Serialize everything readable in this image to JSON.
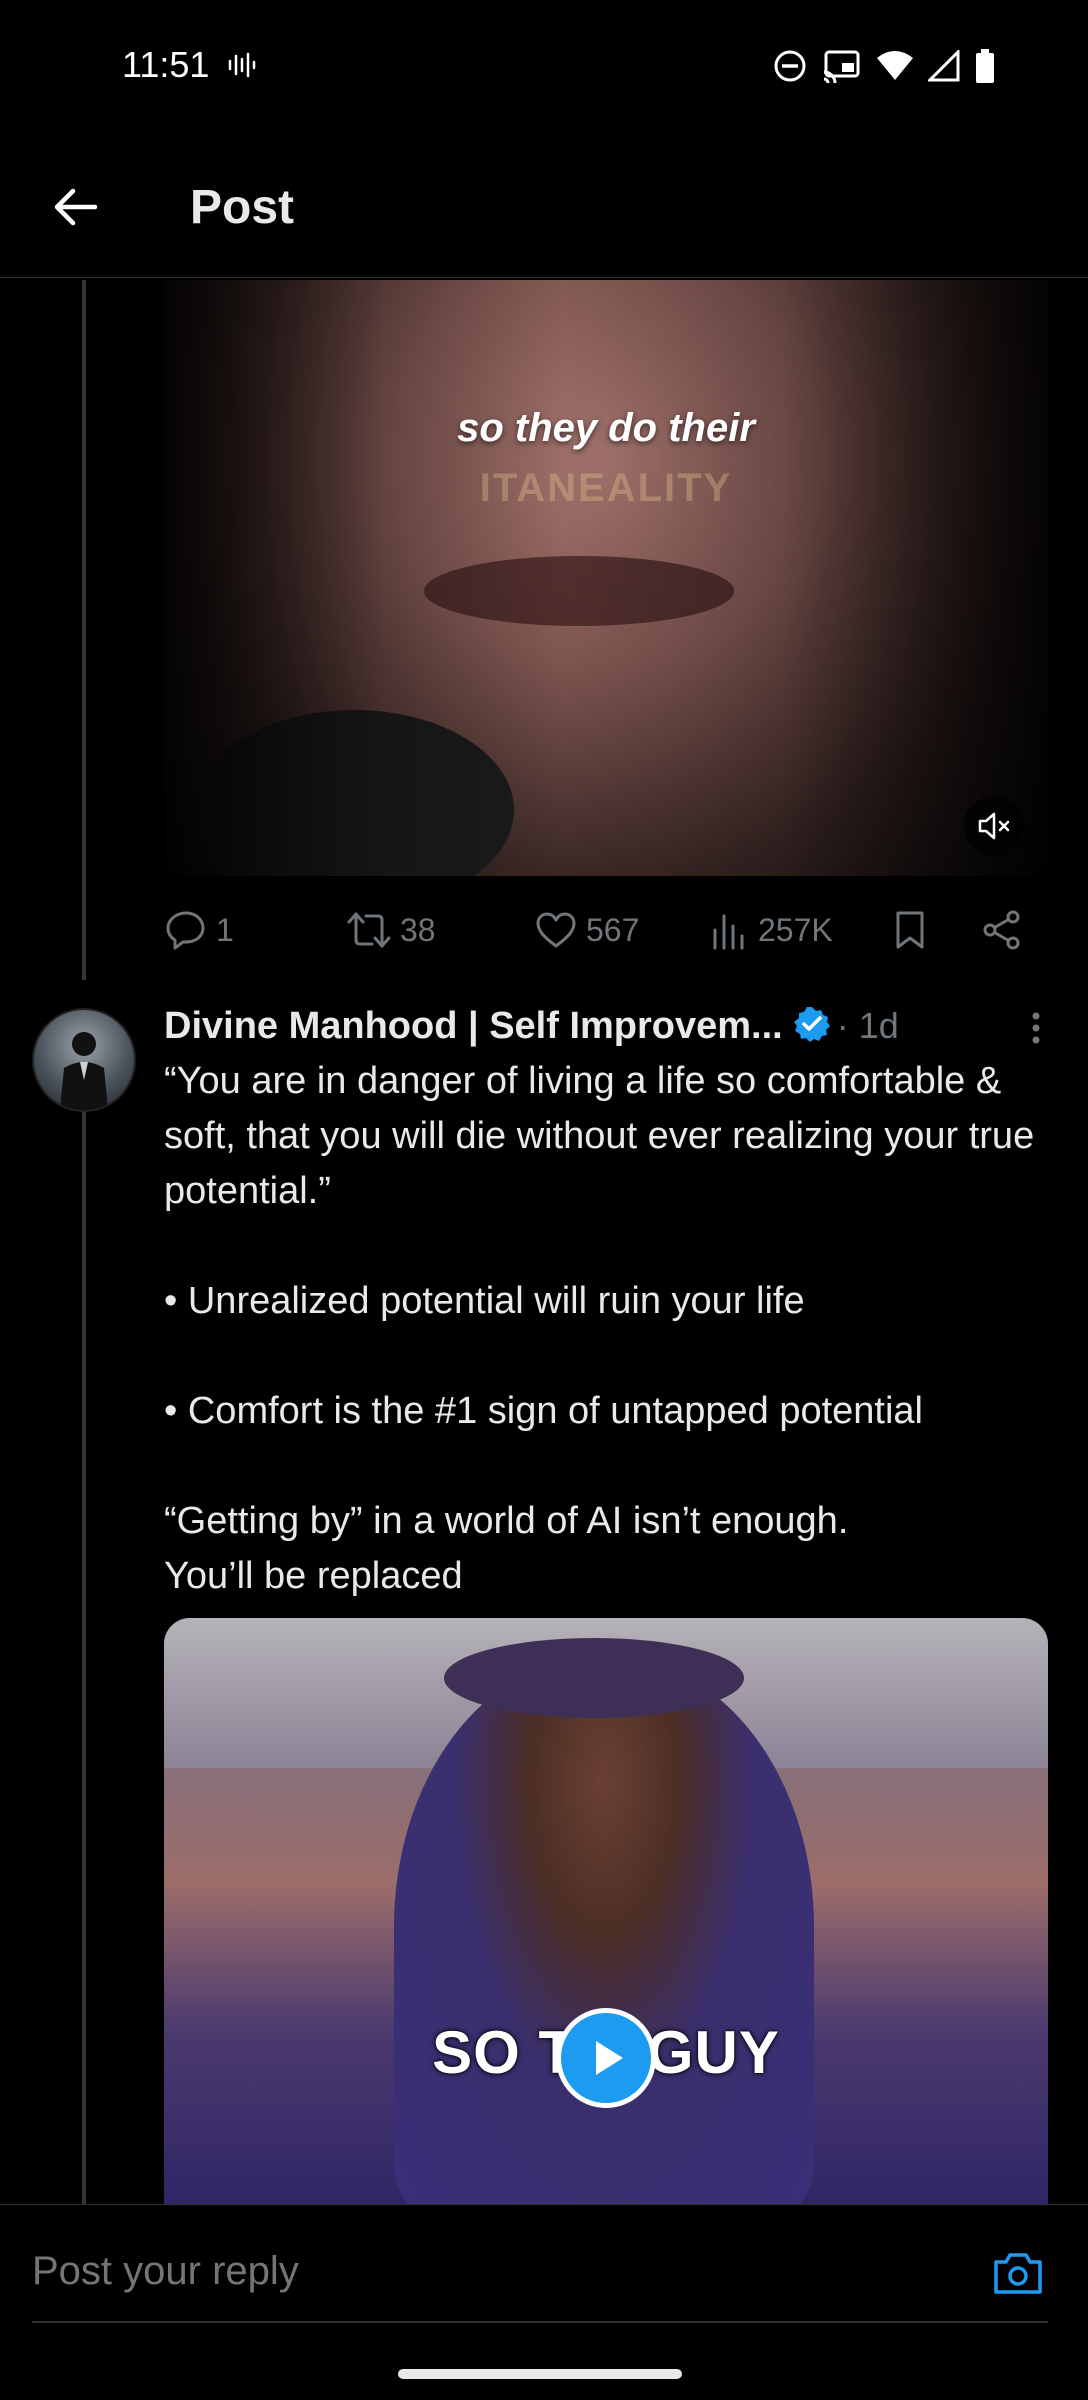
{
  "status_bar": {
    "time": "11:51"
  },
  "header": {
    "title": "Post"
  },
  "media1": {
    "caption_main": "so they do their",
    "caption_faded": "ITANEALITY",
    "muted": true
  },
  "actions": {
    "replies": "1",
    "reposts": "38",
    "likes": "567",
    "views": "257K"
  },
  "post": {
    "author": "Divine Manhood | Self Improvem...",
    "verified": true,
    "time": "· 1d",
    "paragraphs": [
      "“You are in danger of living a life so comfortable & soft, that you will die without ever realizing your true potential.”",
      "• Unrealized potential will ruin your life",
      "• Comfort is the #1 sign of untapped potential",
      "“Getting by” in a world of AI isn’t enough.\nYou’ll be replaced"
    ]
  },
  "media2": {
    "caption": "SO T    GUY"
  },
  "reply_bar": {
    "placeholder": "Post your reply"
  },
  "colors": {
    "background": "#000000",
    "text": "#e7e9ea",
    "muted": "#71767b",
    "accent": "#1d9bf0"
  }
}
